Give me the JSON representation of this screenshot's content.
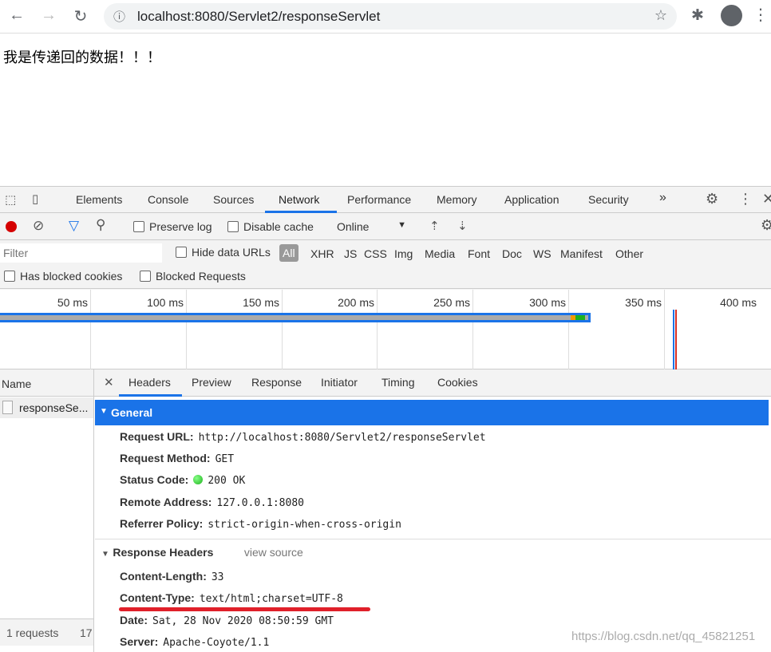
{
  "browser": {
    "url": "localhost:8080/Servlet2/responseServlet"
  },
  "page": {
    "text": "我是传递回的数据！！！"
  },
  "devtools": {
    "tabs": [
      "Elements",
      "Console",
      "Sources",
      "Network",
      "Performance",
      "Memory",
      "Application",
      "Security"
    ],
    "more": "»",
    "active_tab": "Network",
    "toolbar": {
      "preserve_log": "Preserve log",
      "disable_cache": "Disable cache",
      "throttle": "Online"
    },
    "filter": {
      "placeholder": "Filter",
      "hide_data_urls": "Hide data URLs",
      "types": [
        "All",
        "XHR",
        "JS",
        "CSS",
        "Img",
        "Media",
        "Font",
        "Doc",
        "WS",
        "Manifest",
        "Other"
      ],
      "has_blocked_cookies": "Has blocked cookies",
      "blocked_requests": "Blocked Requests"
    },
    "timeline": {
      "ticks": [
        "50 ms",
        "100 ms",
        "150 ms",
        "200 ms",
        "250 ms",
        "300 ms",
        "350 ms",
        "400 ms"
      ]
    },
    "name_column": {
      "header": "Name",
      "items": [
        "responseSe..."
      ],
      "footer_requests": "1 requests",
      "footer_size": "17"
    },
    "detail_tabs": [
      "Headers",
      "Preview",
      "Response",
      "Initiator",
      "Timing",
      "Cookies"
    ],
    "active_detail_tab": "Headers",
    "general": {
      "title": "General",
      "rows": [
        {
          "label": "Request URL:",
          "value": "http://localhost:8080/Servlet2/responseServlet"
        },
        {
          "label": "Request Method:",
          "value": "GET"
        },
        {
          "label": "Status Code:",
          "value": "200 OK"
        },
        {
          "label": "Remote Address:",
          "value": "127.0.0.1:8080"
        },
        {
          "label": "Referrer Policy:",
          "value": "strict-origin-when-cross-origin"
        }
      ]
    },
    "response_headers": {
      "title": "Response Headers",
      "view_source": "view source",
      "rows": [
        {
          "label": "Content-Length:",
          "value": "33"
        },
        {
          "label": "Content-Type:",
          "value": "text/html;charset=UTF-8"
        },
        {
          "label": "Date:",
          "value": "Sat, 28 Nov 2020 08:50:59 GMT"
        },
        {
          "label": "Server:",
          "value": "Apache-Coyote/1.1"
        }
      ]
    }
  },
  "watermark": "https://blog.csdn.net/qq_45821251",
  "colors": {
    "accent": "#1a73e8",
    "status_ok": "#1db21d",
    "annotation": "#e0202a"
  }
}
